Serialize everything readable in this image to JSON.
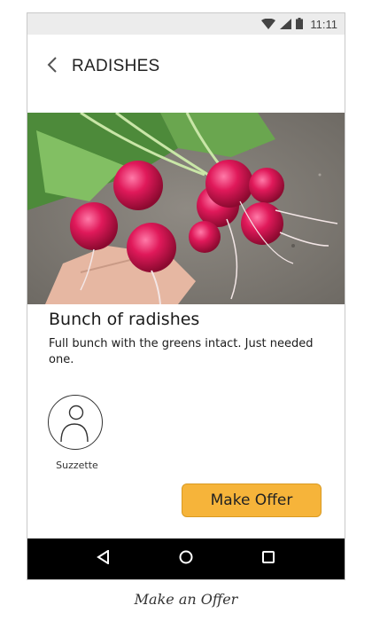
{
  "status_bar": {
    "time": "11:11",
    "icons": [
      "wifi-icon",
      "signal-icon",
      "battery-icon"
    ]
  },
  "header": {
    "title": "RADISHES",
    "back_icon": "chevron-left-icon"
  },
  "listing": {
    "photo_icon": "radish-photo",
    "title": "Bunch of radishes",
    "description": "Full bunch with the greens intact. Just needed one."
  },
  "seller": {
    "name": "Suzzette",
    "avatar_icon": "user-avatar-icon"
  },
  "actions": {
    "make_offer_label": "Make Offer"
  },
  "nav_bar": {
    "icons": [
      "back-triangle-icon",
      "home-circle-icon",
      "recents-square-icon"
    ]
  },
  "caption": "Make an Offer",
  "colors": {
    "accent": "#F6B43A",
    "nav_bar": "#000000",
    "status_bar": "#ECECEC"
  }
}
